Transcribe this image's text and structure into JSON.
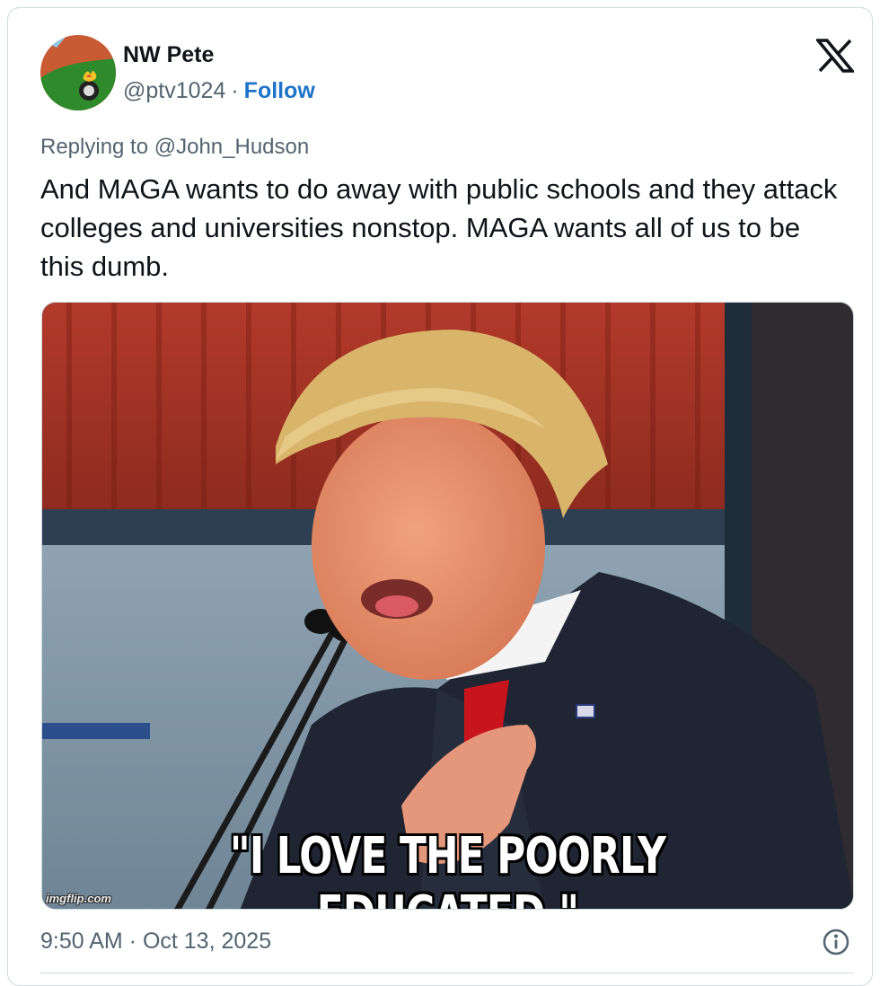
{
  "author": {
    "name": "NW Pete",
    "handle": "@ptv1024",
    "separator": "·",
    "follow_label": "Follow",
    "avatar_icon": "avatar-illustration"
  },
  "platform_icon": "x-logo-icon",
  "reply_context": "Replying to @John_Hudson",
  "tweet_text": "And MAGA wants to do away with public schools and they attack colleges and universities nonstop. MAGA wants all of us to be this dumb.",
  "media": {
    "caption": "\"I LOVE THE POORLY EDUCATED.\"",
    "watermark": "imgflip.com"
  },
  "timestamp": "9:50 AM · Oct 13, 2025",
  "info_icon": "info-icon",
  "colors": {
    "follow": "#1d74c9",
    "secondary_text": "#536471",
    "border": "#cfd9de"
  }
}
